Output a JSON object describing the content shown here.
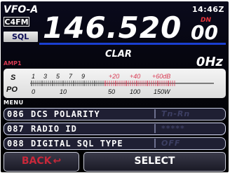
{
  "header": {
    "vfo_label": "VFO-A",
    "clock": "14:46Z",
    "mode": "C4FM",
    "sql": "SQL",
    "dn_tag": "DN"
  },
  "frequency": {
    "main": "146.520",
    "fine": "00"
  },
  "clar": {
    "label": "CLAR",
    "offset": "0Hz"
  },
  "amp_label": "AMP1",
  "meter": {
    "s_label": "S",
    "po_label": "PO",
    "s_scale": [
      "1",
      "3",
      "5",
      "7",
      "9",
      "+20",
      "+40",
      "+60dB"
    ],
    "po_scale": [
      "0",
      "10",
      "50",
      "100",
      "150W"
    ]
  },
  "menu": {
    "title": "MENU",
    "items": [
      {
        "number": "086",
        "name": "DCS POLARITY",
        "value": "Tn-Rn"
      },
      {
        "number": "087",
        "name": "RADIO ID",
        "value": "*****"
      },
      {
        "number": "088",
        "name": "DIGITAL SQL TYPE",
        "value": "OFF"
      }
    ]
  },
  "buttons": {
    "back": "BACK",
    "select": "SELECT"
  },
  "colors": {
    "accent_blue": "#1a3fd1",
    "back_red": "#c8283a",
    "amp_red": "#d63a52",
    "meter_red": "#d93b54"
  }
}
